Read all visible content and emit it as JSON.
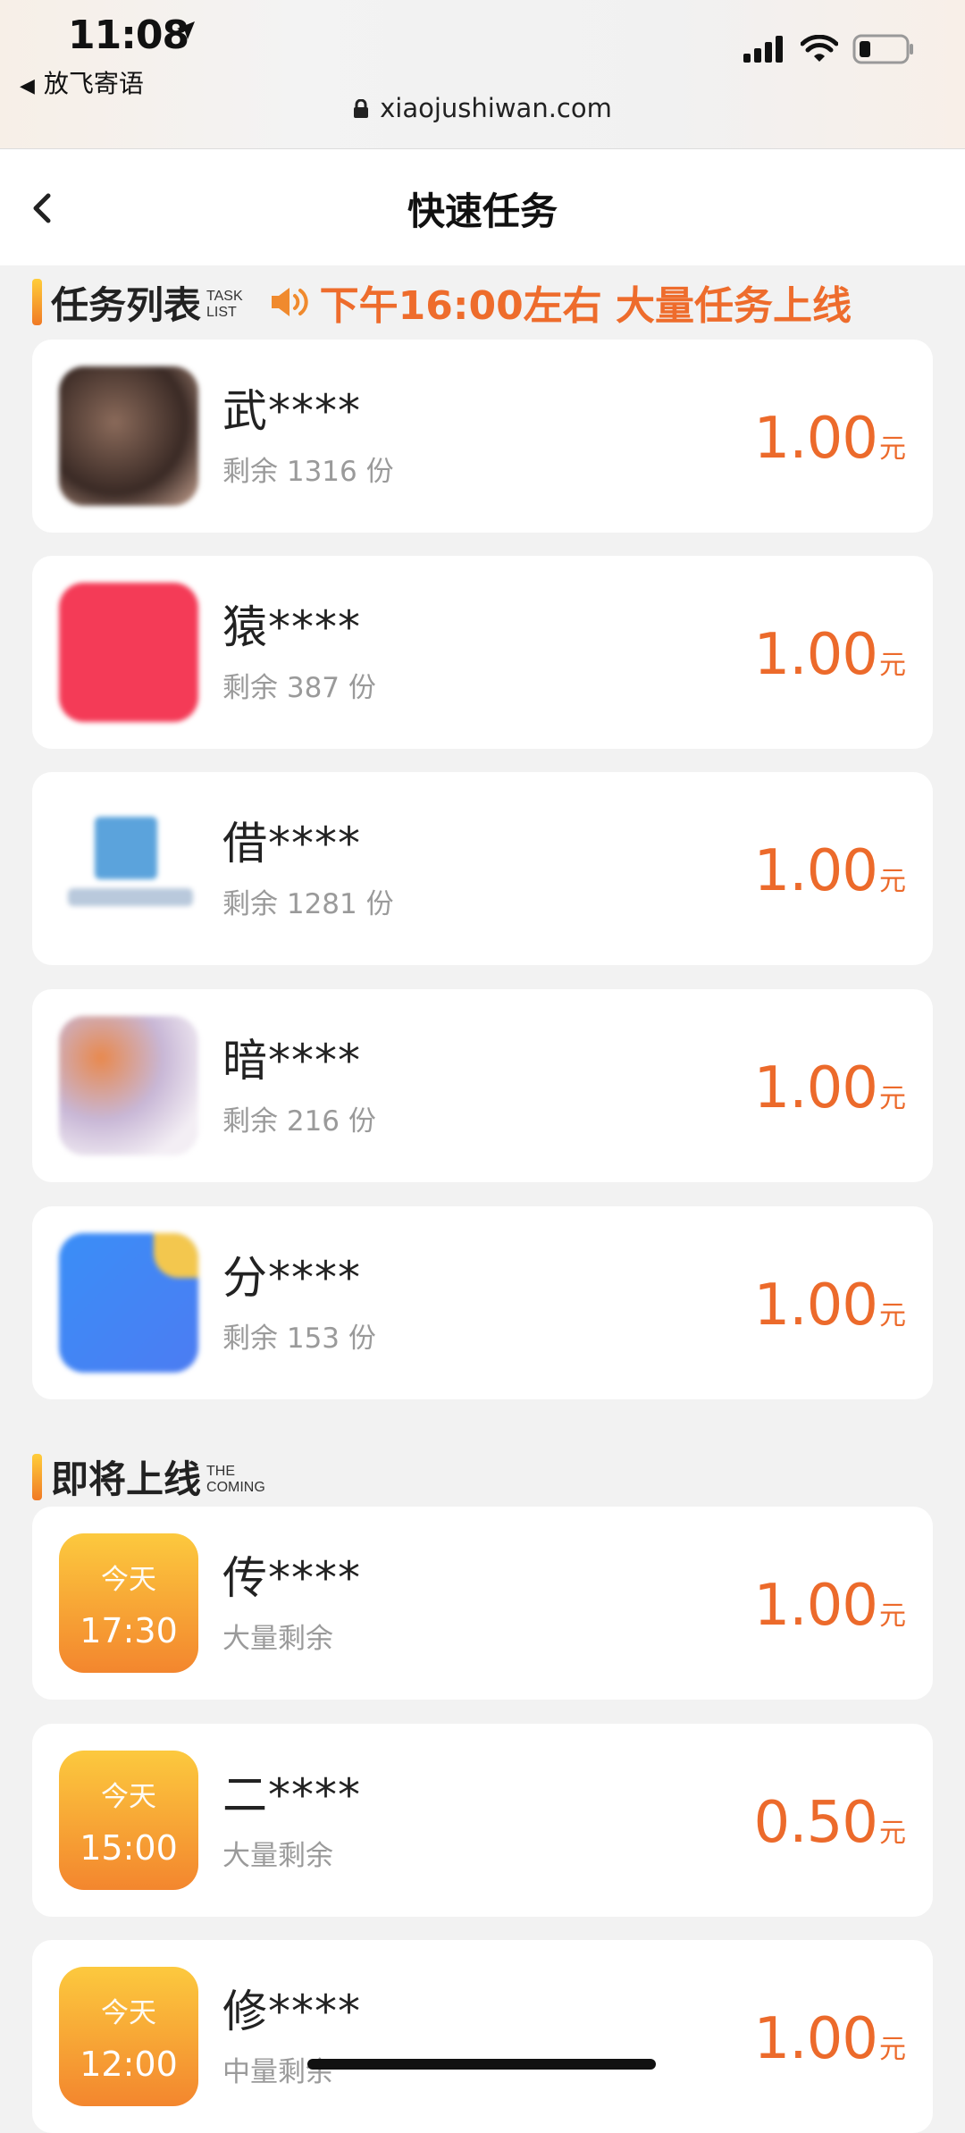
{
  "status_bar": {
    "time": "11:08",
    "back_app": "放飞寄语",
    "url": "xiaojushiwan.com"
  },
  "header": {
    "title": "快速任务"
  },
  "task_section": {
    "title": "任务列表",
    "sub_line1": "TASK",
    "sub_line2": "LIST",
    "notice": "下午16:00左右 大量任务上线"
  },
  "tasks": [
    {
      "name": "武****",
      "remaining": "剩余 1316 份",
      "price": "1.00",
      "unit": "元"
    },
    {
      "name": "猿****",
      "remaining": "剩余 387 份",
      "price": "1.00",
      "unit": "元"
    },
    {
      "name": "借****",
      "remaining": "剩余 1281 份",
      "price": "1.00",
      "unit": "元"
    },
    {
      "name": "暗****",
      "remaining": "剩余 216 份",
      "price": "1.00",
      "unit": "元"
    },
    {
      "name": "分****",
      "remaining": "剩余 153 份",
      "price": "1.00",
      "unit": "元"
    }
  ],
  "coming_section": {
    "title": "即将上线",
    "sub_line1": "THE",
    "sub_line2": "COMING"
  },
  "coming": [
    {
      "day": "今天",
      "time": "17:30",
      "name": "传****",
      "remaining": "大量剩余",
      "price": "1.00",
      "unit": "元"
    },
    {
      "day": "今天",
      "time": "15:00",
      "name": "二****",
      "remaining": "大量剩余",
      "price": "0.50",
      "unit": "元"
    },
    {
      "day": "今天",
      "time": "12:00",
      "name": "修****",
      "remaining": "中量剩余",
      "price": "1.00",
      "unit": "元"
    }
  ],
  "colors": {
    "accent": "#ec6a2b",
    "badge_top": "#fcc93e",
    "badge_bottom": "#f3862e"
  }
}
